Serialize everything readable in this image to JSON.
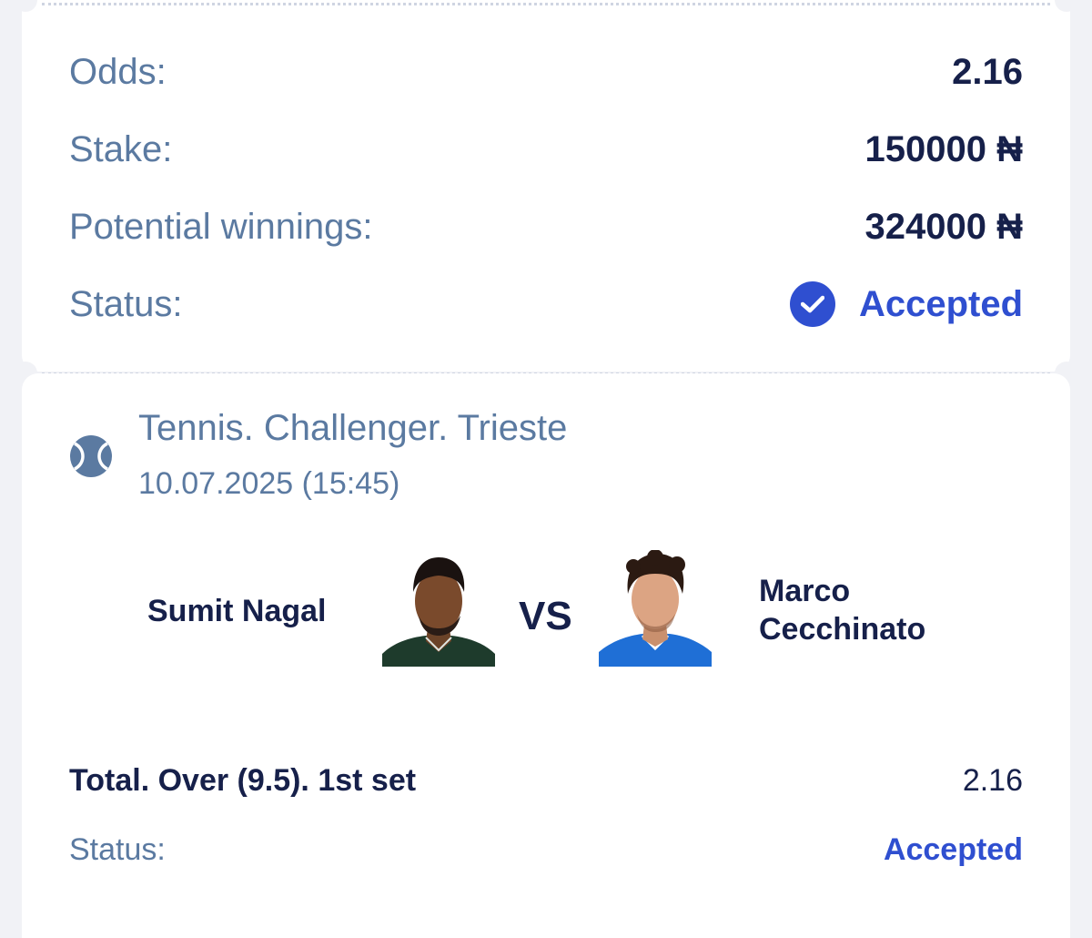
{
  "summary": {
    "odds_label": "Odds:",
    "odds_value": "2.16",
    "stake_label": "Stake:",
    "stake_value": "150000 ₦",
    "winnings_label": "Potential winnings:",
    "winnings_value": "324000 ₦",
    "status_label": "Status:",
    "status_value": "Accepted"
  },
  "event": {
    "title": "Tennis. Challenger. Trieste",
    "datetime": "10.07.2025 (15:45)",
    "player1": "Sumit Nagal",
    "versus": "VS",
    "player2": "Marco Cecchinato"
  },
  "selection": {
    "market": "Total. Over (9.5). 1st set",
    "odds": "2.16",
    "status_label": "Status:",
    "status_value": "Accepted"
  },
  "colors": {
    "accent": "#2f4fd0",
    "label": "#5b7aa1",
    "value": "#16204a",
    "background": "#f1f2f6"
  },
  "icons": {
    "status": "check-circle-icon",
    "sport": "tennis-ball-icon"
  }
}
